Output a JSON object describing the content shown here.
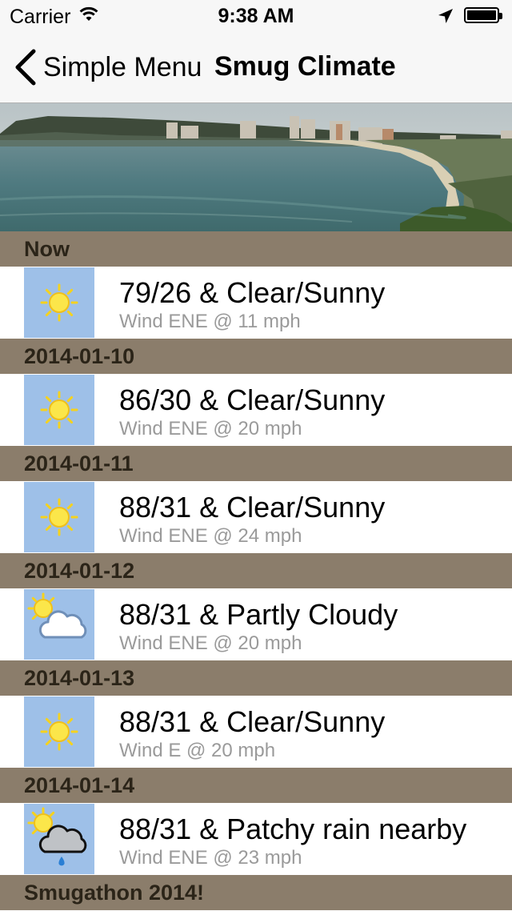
{
  "status_bar": {
    "carrier": "Carrier",
    "time": "9:38 AM"
  },
  "nav": {
    "back_label": "Simple Menu",
    "title": "Smug Climate"
  },
  "forecast": [
    {
      "header": "Now",
      "summary": "79/26 & Clear/Sunny",
      "wind": "Wind ENE @ 11 mph",
      "icon": "sun-icon"
    },
    {
      "header": "2014-01-10",
      "summary": "86/30 & Clear/Sunny",
      "wind": "Wind ENE @ 20 mph",
      "icon": "sun-icon"
    },
    {
      "header": "2014-01-11",
      "summary": "88/31 & Clear/Sunny",
      "wind": "Wind ENE @ 24 mph",
      "icon": "sun-icon"
    },
    {
      "header": "2014-01-12",
      "summary": "88/31 & Partly Cloudy",
      "wind": "Wind ENE @ 20 mph",
      "icon": "partly-cloudy-icon"
    },
    {
      "header": "2014-01-13",
      "summary": "88/31 & Clear/Sunny",
      "wind": "Wind E @ 20 mph",
      "icon": "sun-icon"
    },
    {
      "header": "2014-01-14",
      "summary": "88/31 & Patchy rain nearby",
      "wind": "Wind ENE @ 23 mph",
      "icon": "patchy-rain-icon"
    }
  ],
  "footer_header": "Smugathon 2014!",
  "colors": {
    "section_header": "#8b7d6b",
    "icon_background": "#9ec0e8"
  }
}
